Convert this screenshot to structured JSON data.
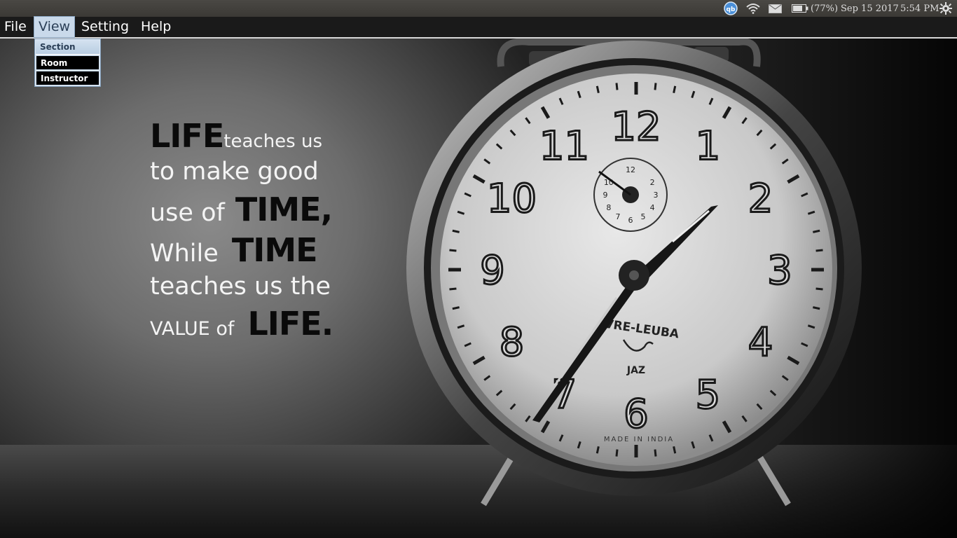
{
  "panel": {
    "battery_text": "(77%)",
    "date": "Sep 15 2017",
    "time": "5:54 PM",
    "icons": [
      "app-indicator-icon",
      "wifi-icon",
      "mail-icon",
      "battery-icon",
      "settings-gear-icon"
    ]
  },
  "menubar": {
    "items": [
      "File",
      "View",
      "Setting",
      "Help"
    ],
    "open_menu": "View"
  },
  "view_menu": {
    "items": [
      "Section",
      "Room",
      "Instructor"
    ],
    "highlighted": "Section"
  },
  "wallpaper": {
    "quote": {
      "line1_big": "LIFE",
      "line1_rest": "teaches us",
      "line2": "to make good",
      "line3_pre": "use of",
      "line3_big": "TIME,",
      "line4_pre": "While",
      "line4_big": "TIME",
      "line5": "teaches us the",
      "line6_pre": "VALUE of",
      "line6_big": "LIFE."
    },
    "clock": {
      "numerals": [
        "12",
        "1",
        "2",
        "3",
        "4",
        "5",
        "6",
        "7",
        "8",
        "9",
        "10",
        "11"
      ],
      "brand": "VRE-LEUBA",
      "sub_brand": "JAZ",
      "made_in": "MADE IN INDIA",
      "small_dial": [
        "12",
        "2",
        "3",
        "4",
        "5",
        "6",
        "7",
        "8",
        "9",
        "10"
      ]
    }
  }
}
